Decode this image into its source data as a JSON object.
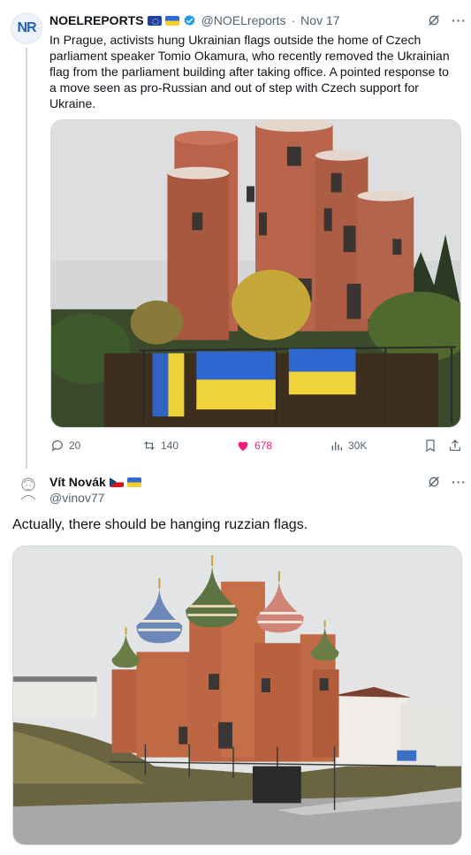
{
  "tweet": {
    "avatar_text": "NR",
    "display_name": "NOELREPORTS",
    "handle": "@NOELreports",
    "separator": "·",
    "date": "Nov 17",
    "text": "In Prague, activists hung Ukrainian flags outside the home of Czech parliament speaker Tomio Okamura, who recently removed the Ukrainian flag from the parliament building after taking office. A pointed response to a move seen as pro-Russian and out of step with Czech support for Ukraine.",
    "more_label": "···",
    "media_icon": "photo-brick-house-with-ukrainian-flags",
    "stats": {
      "replies": "20",
      "reposts": "140",
      "likes": "678",
      "views": "30K"
    }
  },
  "reply": {
    "display_name": "Vít Novák",
    "handle": "@vinov77",
    "text": "Actually, there should be hanging ruzzian flags.",
    "more_label": "···",
    "media_icon": "photo-brick-house-with-onion-domes"
  },
  "colors": {
    "text_primary": "#0f1419",
    "text_secondary": "#536471",
    "like_pink": "#f91880",
    "border": "#cfd9de",
    "verified_blue": "#1d9bf0"
  }
}
